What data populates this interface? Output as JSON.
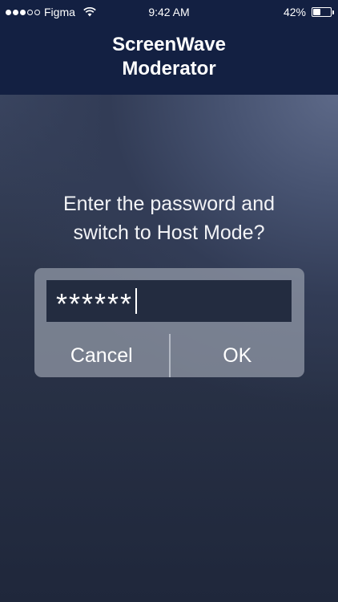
{
  "status_bar": {
    "signal_bars": {
      "filled": 3,
      "total": 5
    },
    "carrier": "Figma",
    "wifi_icon": "wifi-icon",
    "time": "9:42 AM",
    "battery_percent": "42%",
    "battery_level": 0.42
  },
  "header": {
    "title_line1": "ScreenWave",
    "title_line2": "Moderator",
    "background_color": "#132042"
  },
  "prompt": {
    "line1": "Enter the password and",
    "line2": "switch to Host Mode?"
  },
  "dialog": {
    "password_value": "******",
    "cancel_label": "Cancel",
    "ok_label": "OK"
  }
}
